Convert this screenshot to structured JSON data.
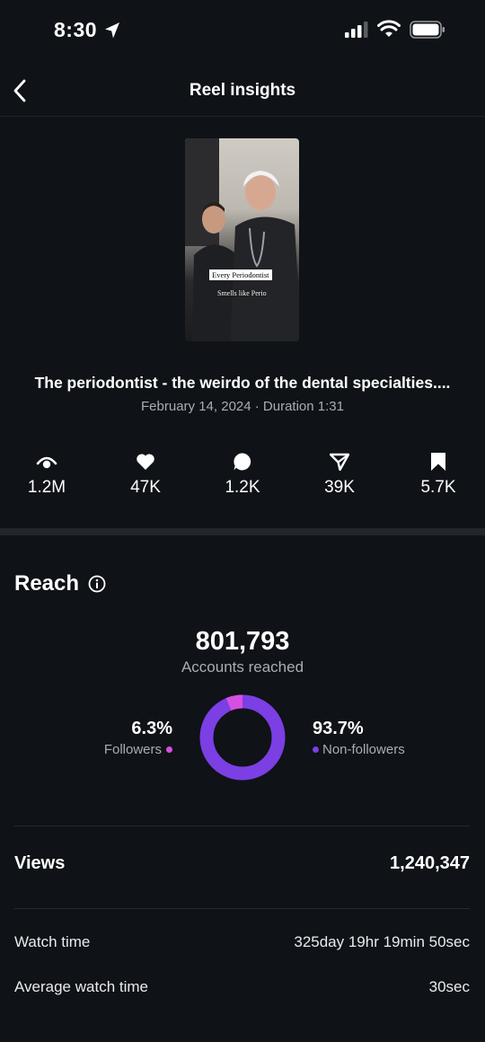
{
  "status_bar": {
    "time": "8:30"
  },
  "nav": {
    "title": "Reel insights"
  },
  "reel": {
    "caption_line1": "Every Periodontist",
    "caption_line2": "Smells like Perio",
    "title": "The periodontist - the weirdo of the dental specialties....",
    "meta": "February 14, 2024 · Duration 1:31"
  },
  "stats": [
    {
      "icon": "eye-icon",
      "value": "1.2M"
    },
    {
      "icon": "heart-icon",
      "value": "47K"
    },
    {
      "icon": "comment-icon",
      "value": "1.2K"
    },
    {
      "icon": "share-icon",
      "value": "39K"
    },
    {
      "icon": "bookmark-icon",
      "value": "5.7K"
    }
  ],
  "reach": {
    "title": "Reach",
    "number": "801,793",
    "label": "Accounts reached",
    "followers_pct": "6.3%",
    "followers_label": "Followers",
    "nonfollowers_pct": "93.7%",
    "nonfollowers_label": "Non-followers",
    "followers_fraction": 0.063,
    "colors": {
      "followers": "#d64fe0",
      "nonfollowers": "#7b3fe4"
    }
  },
  "views": {
    "label": "Views",
    "value": "1,240,347"
  },
  "watch_time": {
    "label": "Watch time",
    "value": "325day 19hr 19min 50sec"
  },
  "avg_watch_time": {
    "label": "Average watch time",
    "value": "30sec"
  }
}
